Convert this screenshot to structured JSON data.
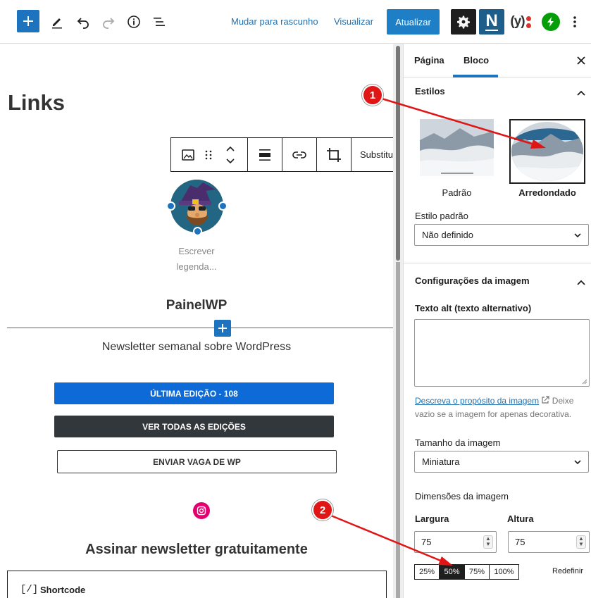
{
  "toolbar": {
    "mudar_label": "Mudar para rascunho",
    "visualizar_label": "Visualizar",
    "atualizar_label": "Atualizar",
    "n_label": "N",
    "yoast_label": "(y)"
  },
  "editor": {
    "title": "Links",
    "block_toolbar_substituir": "Substitu",
    "caption_line1": "Escrever",
    "caption_line2": "legenda...",
    "heading": "PainelWP",
    "subtitle": "Newsletter semanal sobre WordPress",
    "button1": "ÚLTIMA EDIÇÃO - 108",
    "button2": "VER TODAS AS EDIÇÕES",
    "button3": "ENVIAR VAGA DE WP",
    "newsletter_heading": "Assinar newsletter gratuitamente",
    "shortcode_icon": "[/]",
    "shortcode_label": "Shortcode"
  },
  "sidebar": {
    "tab_page": "Página",
    "tab_block": "Bloco",
    "styles_title": "Estilos",
    "style1_label": "Padrão",
    "style2_label": "Arredondado",
    "default_style_label": "Estilo padrão",
    "default_style_value": "Não definido",
    "image_settings_title": "Configurações da imagem",
    "alt_label": "Texto alt (texto alternativo)",
    "alt_link": "Descreva o propósito da imagem",
    "alt_help_1": "Deixe",
    "alt_help_2": "vazio se a imagem for apenas decorativa.",
    "size_label": "Tamanho da imagem",
    "size_value": "Miniatura",
    "dimensions_label": "Dimensões da imagem",
    "width_label": "Largura",
    "height_label": "Altura",
    "width_value": "75",
    "height_value": "75",
    "pct_25": "25%",
    "pct_50": "50%",
    "pct_75": "75%",
    "pct_100": "100%",
    "reset_label": "Redefinir"
  },
  "annotations": {
    "marker1": "1",
    "marker2": "2"
  },
  "colors": {
    "accent": "#1e7fc6",
    "dark_button": "#32373c",
    "instagram": "#e4006f",
    "annotation_red": "#e01515"
  }
}
